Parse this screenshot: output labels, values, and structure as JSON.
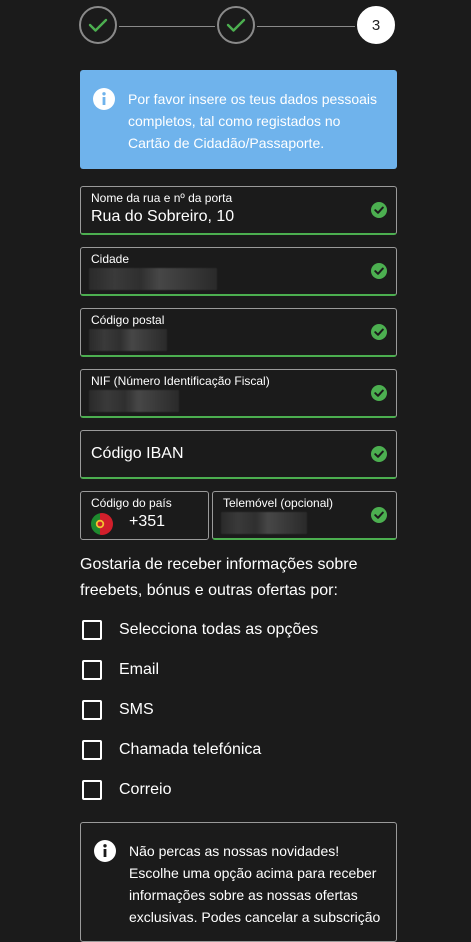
{
  "stepper": {
    "steps": [
      {
        "state": "done"
      },
      {
        "state": "done"
      },
      {
        "state": "current",
        "label": "3"
      }
    ]
  },
  "info_banner": {
    "text": "Por favor insere os teus dados pessoais completos, tal como registados no Cartão de Cidadão/Passaporte.",
    "color": "#6fb3ec"
  },
  "fields": {
    "street": {
      "label": "Nome da rua e nº da porta",
      "value": "Rua do Sobreiro, 10"
    },
    "city": {
      "label": "Cidade"
    },
    "postal": {
      "label": "Código postal"
    },
    "nif": {
      "label": "NIF (Número Identificação Fiscal)"
    },
    "iban": {
      "placeholder": "Código IBAN"
    },
    "country": {
      "label": "Código do país",
      "value": "+351"
    },
    "phone": {
      "label": "Telemóvel (opcional)"
    }
  },
  "question": "Gostaria de receber informações sobre freebets, bónus e outras ofertas por:",
  "options": [
    {
      "label": "Selecciona todas as opções",
      "checked": false
    },
    {
      "label": "Email",
      "checked": false
    },
    {
      "label": "SMS",
      "checked": false
    },
    {
      "label": "Chamada telefónica",
      "checked": false
    },
    {
      "label": "Correio",
      "checked": false
    }
  ],
  "notice": {
    "text": "Não percas as nossas novidades! Escolhe uma opção acima para receber informações sobre as nossas ofertas exclusivas. Podes cancelar a subscrição"
  },
  "colors": {
    "valid": "#4caf50",
    "background": "#1b1b1b"
  }
}
